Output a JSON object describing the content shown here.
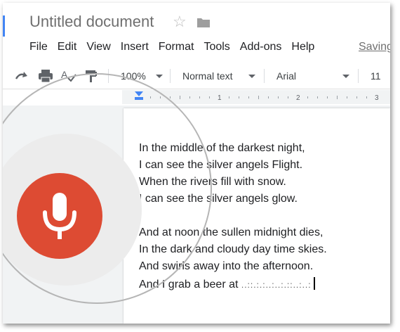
{
  "app": {
    "title": "Untitled document",
    "saving_text": "Saving..."
  },
  "menu": [
    "File",
    "Edit",
    "View",
    "Insert",
    "Format",
    "Tools",
    "Add-ons",
    "Help"
  ],
  "toolbar": {
    "redo_icon": "redo-icon",
    "print_icon": "print-icon",
    "spellcheck_icon": "spellcheck-icon",
    "paint_format_icon": "paint-format-icon",
    "zoom": "100%",
    "style": "Normal text",
    "font": "Arial",
    "font_size": "11"
  },
  "ruler": {
    "marks": [
      "1",
      "2",
      "3"
    ]
  },
  "document": {
    "lines": [
      "In the middle of the darkest night,",
      "I can see the silver angels Flight.",
      "When the rivers fill with snow.",
      "I can see the silver angels glow.",
      "",
      "And at noon the sullen midnight dies,",
      "In the dark and cloudy day time skies.",
      "And swirls away into the afternoon.",
      "And I grab a beer at"
    ],
    "dictation_placeholder": "..::.:.:..:..:.::..:..:"
  },
  "voice_typing": {
    "icon": "microphone-icon"
  },
  "colors": {
    "mic_button": "#dd4b33",
    "mic_panel": "#ececec",
    "ruler_indent": "#4285f4"
  }
}
